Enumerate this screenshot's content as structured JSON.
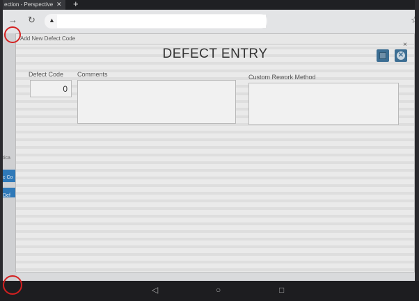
{
  "browser": {
    "tab_title": "ection - Perspective",
    "tab_close": "✕",
    "new_tab": "+",
    "back_icon": "→",
    "reload_icon": "↻",
    "lock_icon": "▲",
    "star_icon": "☆"
  },
  "background_page": {
    "label_partial": "tica",
    "blue_item_1": "c Co",
    "blue_item_2": "Def"
  },
  "popup": {
    "title": "Add New Defect Code",
    "close": "×"
  },
  "form": {
    "heading": "DEFECT ENTRY",
    "cancel_glyph": "✕",
    "defect_code_label": "Defect Code",
    "defect_code_value": "0",
    "comments_label": "Comments",
    "comments_value": "",
    "rework_label": "Custom Rework Method",
    "rework_value": ""
  },
  "android_nav": {
    "back": "◁",
    "home": "○",
    "recents": "□"
  },
  "colors": {
    "accent_button": "#3c6e93",
    "annotation_red": "#d42020"
  }
}
